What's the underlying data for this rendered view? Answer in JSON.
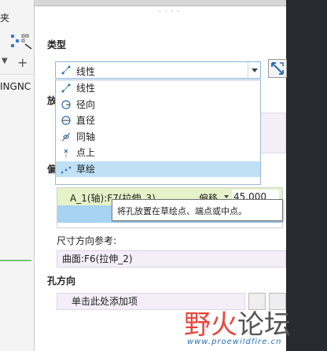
{
  "left_panel": {
    "title_fragment": "夹",
    "code_fragment": "INGNC"
  },
  "panel": {
    "grip": "· · · ·",
    "type_label": "类型",
    "type_selected": "线性",
    "type_options": [
      {
        "label": "线性",
        "icon": "linear-icon"
      },
      {
        "label": "径向",
        "icon": "radial-icon"
      },
      {
        "label": "直径",
        "icon": "diameter-icon"
      },
      {
        "label": "同轴",
        "icon": "coaxial-icon"
      },
      {
        "label": "点上",
        "icon": "on-point-icon"
      },
      {
        "label": "草绘",
        "icon": "sketch-icon"
      }
    ],
    "behind_label_1": "放",
    "behind_label_2": "偏",
    "reference_row": {
      "name": "A_1(轴):F7(拉伸_3)",
      "type": "偏移",
      "value": "45.000"
    },
    "tooltip": "将孔放置在草绘点、端点或中点。",
    "dim_ref_label": "尺寸方向参考:",
    "dim_ref_value": "曲面:F6(拉伸_2)",
    "hole_dir_label": "孔方向",
    "hole_dir_placeholder": "单击此处添加项"
  },
  "watermark": {
    "text_a": "野",
    "text_b": "火",
    "text_c": "论坛",
    "url": "www.proewildfire.cn"
  }
}
